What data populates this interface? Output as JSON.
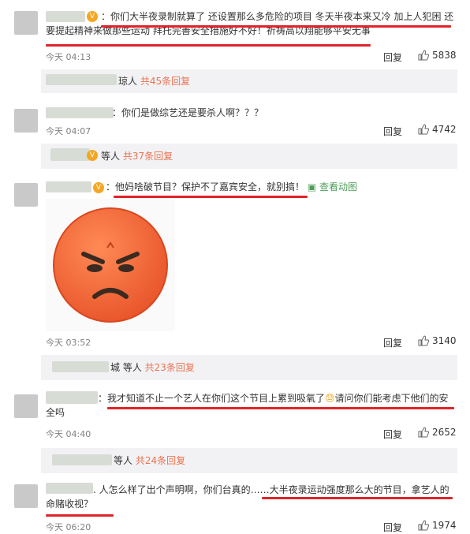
{
  "comments": [
    {
      "text": "：你们大半夜录制就算了 还设置那么多危险的项目 冬天半夜本来又冷 加上人犯困 还要提起精神来做那些运动 拜托完善安全措施好不好！祈祷高以翔能够平安无事",
      "time": "今天 04:13",
      "reply": "回复",
      "likes": "5838",
      "sub": {
        "name": "琼人",
        "count": "共45条回复"
      }
    },
    {
      "text": "：你们是做综艺还是要杀人啊？？？",
      "time": "今天 04:07",
      "reply": "回复",
      "likes": "4742",
      "sub": {
        "name": "等人",
        "count": "共37条回复"
      }
    },
    {
      "text": "：他妈啥破节目？保护不了嘉宾安全，就别搞！",
      "view_anim": "查看动图",
      "time": "今天 03:52",
      "reply": "回复",
      "likes": "3140",
      "sub": {
        "name": "城 等人",
        "count": "共23条回复"
      }
    },
    {
      "text_a": "：我才知道不止一个艺人在你们这个节目上累到吸氧了",
      "text_b": "请问你们能考虑下他们的安全吗",
      "time": "今天 04:40",
      "reply": "回复",
      "likes": "2652",
      "sub": {
        "name": "等人",
        "count": "共24条回复"
      }
    },
    {
      "text": ". 人怎么样了出个声明啊，你们台真的……大半夜录运动强度那么大的节目，拿艺人的命赌收视？",
      "time": "今天 06:20",
      "reply": "回复",
      "likes": "1974"
    }
  ],
  "colors": {
    "accent": "#eb7350",
    "underline": "#e1232a",
    "subbg": "#f2f2f5"
  }
}
